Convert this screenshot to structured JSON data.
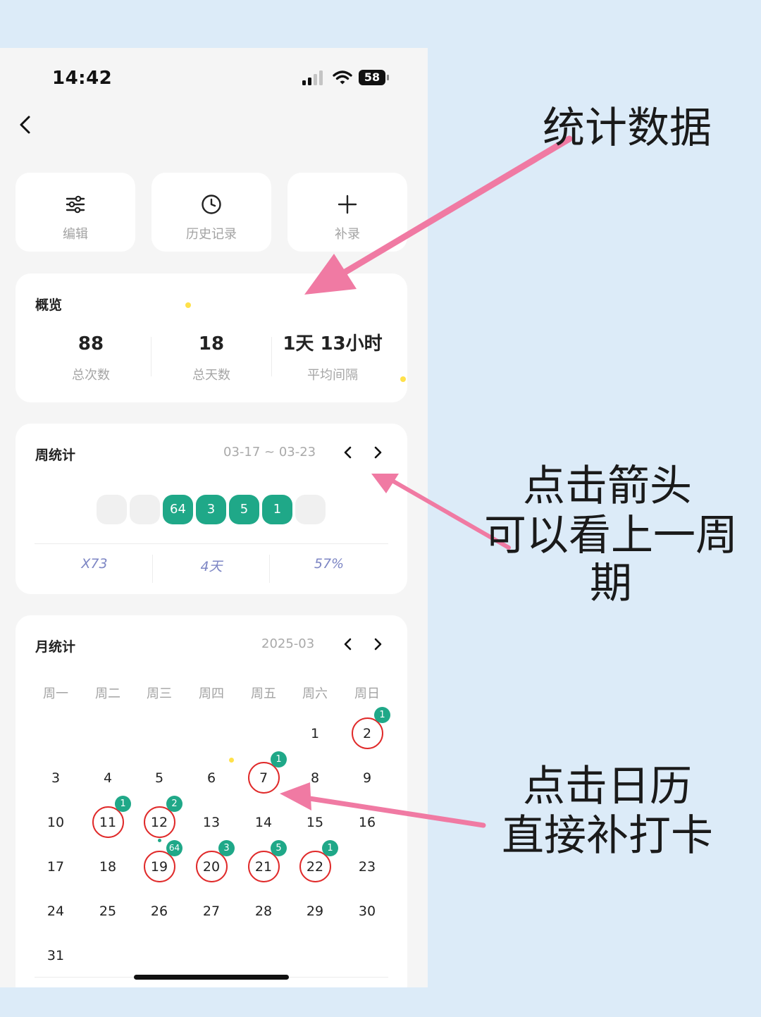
{
  "status_bar": {
    "time": "14:42",
    "battery": "58"
  },
  "actions": [
    {
      "label": "编辑",
      "icon": "sliders-icon"
    },
    {
      "label": "历史记录",
      "icon": "clock-icon"
    },
    {
      "label": "补录",
      "icon": "plus-icon"
    }
  ],
  "overview": {
    "title": "概览",
    "stats": [
      {
        "value": "88",
        "label": "总次数"
      },
      {
        "value": "18",
        "label": "总天数"
      },
      {
        "value": "1天 13小时",
        "label": "平均间隔"
      }
    ]
  },
  "weekly": {
    "title": "周统计",
    "range": "03-17 ~ 03-23",
    "days": [
      {
        "count": "",
        "active": false
      },
      {
        "count": "",
        "active": false
      },
      {
        "count": "64",
        "active": true
      },
      {
        "count": "3",
        "active": true
      },
      {
        "count": "5",
        "active": true
      },
      {
        "count": "1",
        "active": true
      },
      {
        "count": "",
        "active": false
      }
    ],
    "summary": [
      "X73",
      "4天",
      "57%"
    ]
  },
  "monthly": {
    "title": "月统计",
    "month": "2025-03",
    "weekdays": [
      "周一",
      "周二",
      "周三",
      "周四",
      "周五",
      "周六",
      "周日"
    ],
    "days": [
      {
        "d": "1"
      },
      {
        "d": "2",
        "count": "1"
      },
      {
        "d": "3"
      },
      {
        "d": "4"
      },
      {
        "d": "5"
      },
      {
        "d": "6"
      },
      {
        "d": "7",
        "count": "1"
      },
      {
        "d": "8"
      },
      {
        "d": "9"
      },
      {
        "d": "10"
      },
      {
        "d": "11",
        "count": "1"
      },
      {
        "d": "12",
        "count": "2"
      },
      {
        "d": "13"
      },
      {
        "d": "14"
      },
      {
        "d": "15"
      },
      {
        "d": "16"
      },
      {
        "d": "17"
      },
      {
        "d": "18"
      },
      {
        "d": "19",
        "count": "64"
      },
      {
        "d": "20",
        "count": "3"
      },
      {
        "d": "21",
        "count": "5"
      },
      {
        "d": "22",
        "count": "1"
      },
      {
        "d": "23"
      },
      {
        "d": "24"
      },
      {
        "d": "25"
      },
      {
        "d": "26"
      },
      {
        "d": "27"
      },
      {
        "d": "28"
      },
      {
        "d": "29"
      },
      {
        "d": "30"
      },
      {
        "d": "31"
      }
    ]
  },
  "annotations": {
    "stats": "统计数据",
    "arrow_line1": "点击箭头",
    "arrow_line2": "可以看上一周期",
    "calendar_line1": "点击日历",
    "calendar_line2": "直接补打卡"
  },
  "colors": {
    "accent": "#1fa888",
    "ring": "#e02a2a",
    "arrow": "#f07aa3",
    "background": "#dcebf8"
  }
}
